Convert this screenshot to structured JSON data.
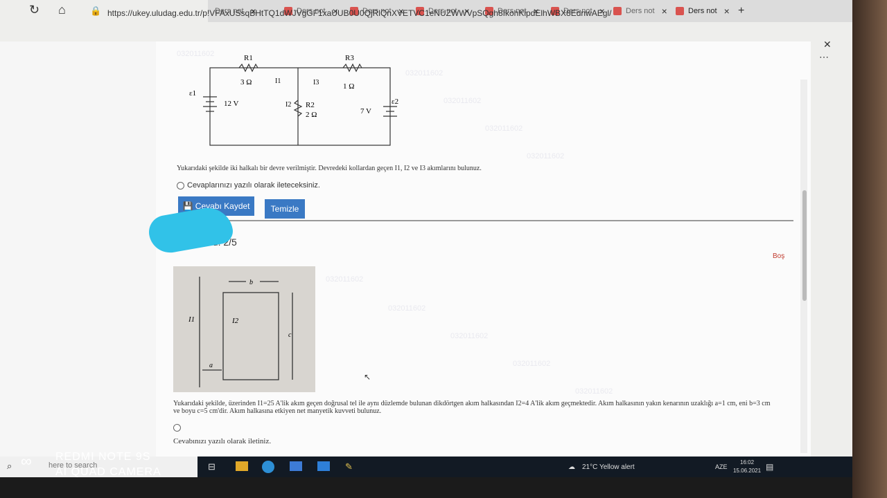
{
  "browser": {
    "tabs": [
      {
        "label": "Ders not"
      },
      {
        "label": "Ders not"
      },
      {
        "label": "Ders not"
      },
      {
        "label": "Ders not"
      },
      {
        "label": "Ders not"
      },
      {
        "label": "Ders not"
      },
      {
        "label": "Ders not"
      },
      {
        "label": "Ders not"
      }
    ],
    "new_tab_symbol": "+",
    "url": "https://ukey.uludag.edu.tr/p!VFAxUSsqBHtTQ1dWJVgGF1xaUUB0U0QjRlQnXVETVC1eNUZWWVpSQgh8IkohKlpdElhWBX8EdnwAEgl/"
  },
  "watermark": "032011602",
  "question1": {
    "circuit": {
      "r1_label": "R1",
      "r1_value": "3 Ω",
      "r3_label": "R3",
      "r3_value": "1 Ω",
      "r2_label": "R2",
      "r2_value": "2 Ω",
      "e1_label": "ε1",
      "e1_value": "12 V",
      "e2_label": "ε2",
      "e2_value": "7 V",
      "i1": "I1",
      "i2": "I2",
      "i3": "I3"
    },
    "text": "Yukarıdaki şekilde iki halkalı bir devre verilmiştir. Devredeki kollardan geçen I1, I2 ve I3 akımlarını bulunuz.",
    "answer_note": "Cevaplarınızı yazılı olarak ileteceksiniz.",
    "save_label": "Cevabı Kaydet",
    "clear_label": "Temizle"
  },
  "question2": {
    "header": "Soru: 2/5",
    "status": "Boş",
    "figure_labels": {
      "b": "b",
      "i1": "I1",
      "i2": "I2",
      "c": "c",
      "a": "a"
    },
    "text": "Yukarıdaki şekilde, üzerinden I1=25 A'lik akım geçen doğrusal tel ile aynı düzlemde bulunan dikdörtgen akım halkasından I2=4 A'lik akım geçmektedir. Akım halkasının yakın kenarının uzaklığı a=1 cm, eni b=3 cm ve boyu c=5 cm'dir. Akım halkasına etkiyen net manyetik kuvveti bulunuz.",
    "answer_note": "Cevabınızı yazılı olarak iletiniz."
  },
  "taskbar": {
    "search_placeholder": "here to search",
    "weather": "21°C  Yellow alert",
    "language": "AZE",
    "time": "16:02",
    "date": "15.06.2021"
  },
  "camera_watermark": {
    "line1": "REDMI NOTE 9S",
    "line2": "AI QUAD CAMERA"
  },
  "colors": {
    "button_blue": "#3a79c4",
    "status_red": "#c0392b",
    "tab_favicon": "#d9534f",
    "wm_gray": "#e9e9ef"
  }
}
